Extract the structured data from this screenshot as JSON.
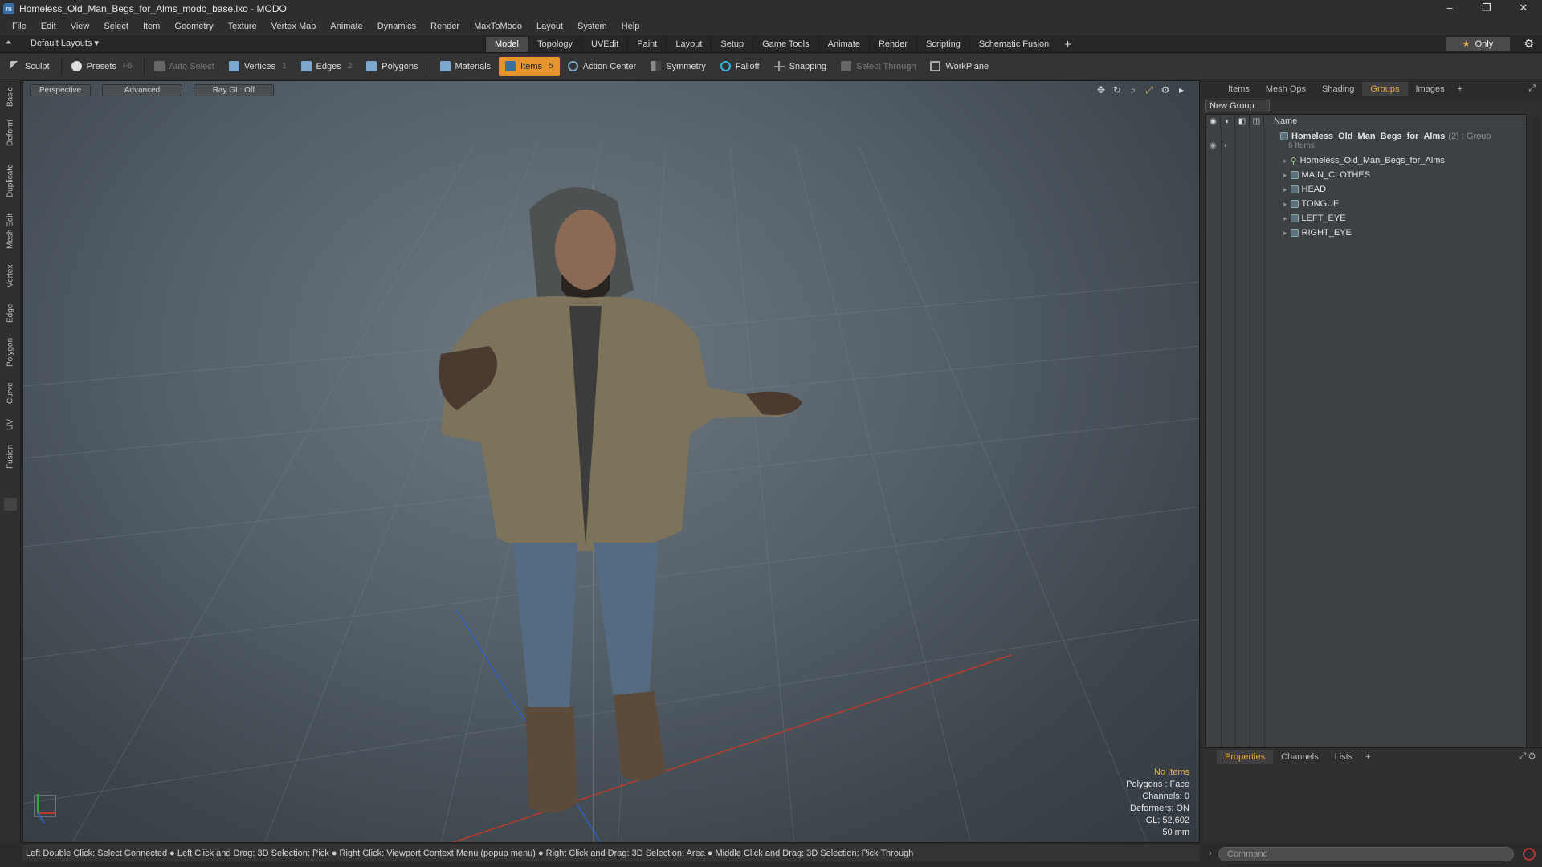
{
  "window": {
    "title": "Homeless_Old_Man_Begs_for_Alms_modo_base.lxo - MODO",
    "minimize": "–",
    "restore": "❐",
    "close": "✕"
  },
  "menu": [
    "File",
    "Edit",
    "View",
    "Select",
    "Item",
    "Geometry",
    "Texture",
    "Vertex Map",
    "Animate",
    "Dynamics",
    "Render",
    "MaxToModo",
    "Layout",
    "System",
    "Help"
  ],
  "layoutbar": {
    "layouts_label": "Default Layouts ▾",
    "tabs": [
      "Model",
      "Topology",
      "UVEdit",
      "Paint",
      "Layout",
      "Setup",
      "Game Tools",
      "Animate",
      "Render",
      "Scripting",
      "Schematic Fusion"
    ],
    "active_tab": "Model",
    "add": "+",
    "only_label": "Only"
  },
  "toolbar": {
    "sculpt": "Sculpt",
    "presets": "Presets",
    "presets_key": "F6",
    "auto_select": "Auto Select",
    "vertices": "Vertices",
    "vertices_key": "1",
    "edges": "Edges",
    "edges_key": "2",
    "polygons": "Polygons",
    "materials": "Materials",
    "items": "Items",
    "items_key": "5",
    "action_center": "Action Center",
    "symmetry": "Symmetry",
    "falloff": "Falloff",
    "snapping": "Snapping",
    "select_through": "Select Through",
    "workplane": "WorkPlane"
  },
  "left_tabs": [
    "Basic",
    "Deform",
    "Duplicate",
    "Mesh Edit",
    "Vertex",
    "Edge",
    "Polygon",
    "Curve",
    "UV",
    "Fusion"
  ],
  "viewport": {
    "perspective": "Perspective",
    "advanced": "Advanced",
    "raygl": "Ray GL: Off",
    "info": {
      "no_items": "No Items",
      "polygons": "Polygons : Face",
      "channels": "Channels: 0",
      "deformers": "Deformers: ON",
      "gl": "GL: 52,602",
      "focal": "50 mm"
    }
  },
  "right_panel": {
    "tabs": [
      "Items",
      "Mesh Ops",
      "Shading",
      "Groups",
      "Images"
    ],
    "active_tab": "Groups",
    "new_group": "New Group",
    "name_header": "Name",
    "group_name": "Homeless_Old_Man_Begs_for_Alms",
    "group_suffix": "(2) : Group",
    "group_count": "6 Items",
    "items": [
      "Homeless_Old_Man_Begs_for_Alms",
      "MAIN_CLOTHES",
      "HEAD",
      "TONGUE",
      "LEFT_EYE",
      "RIGHT_EYE"
    ]
  },
  "bottom_panel": {
    "tabs": [
      "Properties",
      "Channels",
      "Lists"
    ],
    "active_tab": "Properties"
  },
  "status": "Left Double Click: Select Connected ● Left Click and Drag: 3D Selection: Pick ● Right Click: Viewport Context Menu (popup menu) ● Right Click and Drag: 3D Selection: Area ● Middle Click and Drag: 3D Selection: Pick Through",
  "command_placeholder": "Command",
  "colors": {
    "accent": "#e5952c",
    "active_tab_text": "#e8a637",
    "viewport_bg": "#56616a"
  }
}
